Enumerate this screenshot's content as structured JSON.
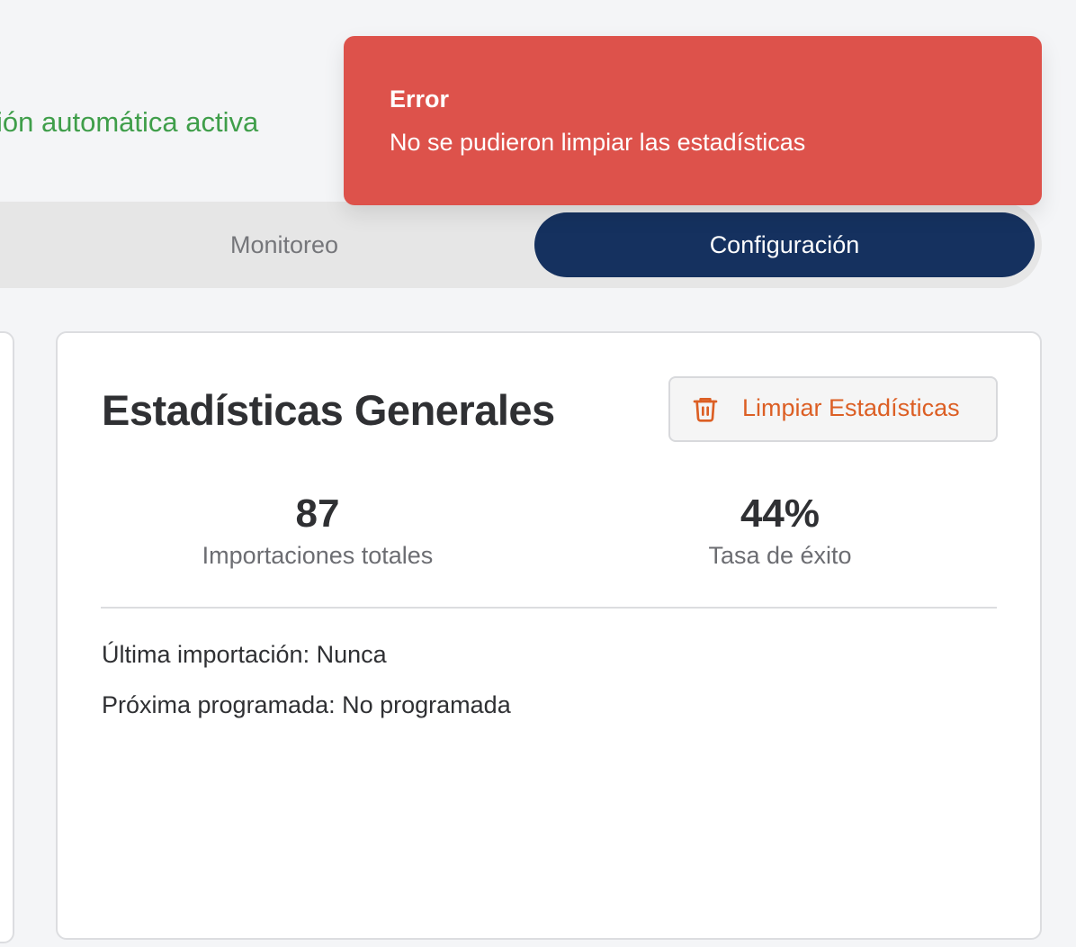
{
  "status": {
    "text": "ión automática activa",
    "color": "#3f9e4a"
  },
  "toast": {
    "title": "Error",
    "message": "No se pudieron limpiar las estadísticas",
    "color": "#dd524b"
  },
  "tabs": [
    {
      "label": "Monitoreo",
      "active": false
    },
    {
      "label": "Configuración",
      "active": true
    }
  ],
  "stats_card": {
    "title": "Estadísticas Generales",
    "clear_button": {
      "label": "Limpiar Estadísticas",
      "icon": "trash-icon",
      "color": "#dc5f24"
    },
    "metrics": [
      {
        "value": "87",
        "label": "Importaciones totales"
      },
      {
        "value": "44%",
        "label": "Tasa de éxito"
      }
    ],
    "last_import": "Última importación: Nunca",
    "next_scheduled": "Próxima programada: No programada"
  },
  "colors": {
    "active_tab": "#15315f",
    "background": "#f4f5f7"
  }
}
